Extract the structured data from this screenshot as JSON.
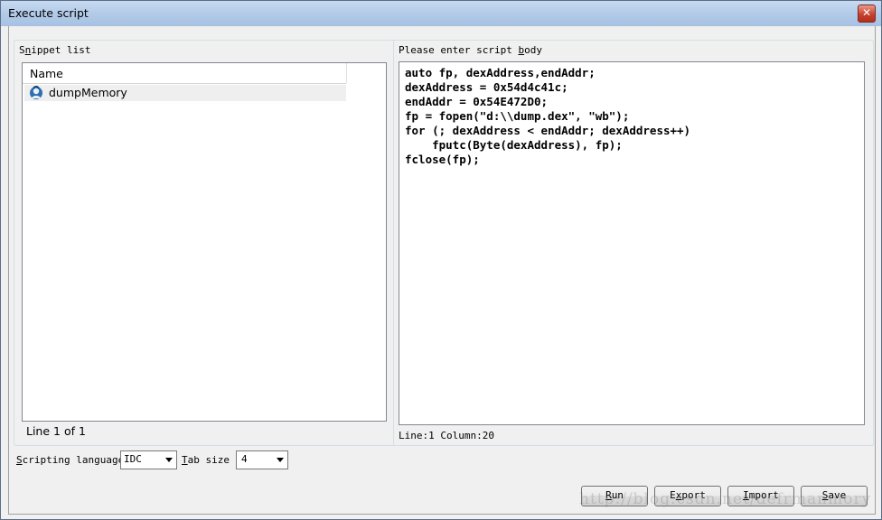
{
  "window": {
    "title": "Execute script",
    "close_glyph": "✕"
  },
  "snippet_list": {
    "group_label_prefix": "S",
    "group_label_accel": "n",
    "group_label_rest": "ippet list",
    "column_header": "Name",
    "items": [
      {
        "label": "dumpMemory",
        "icon": "snippet-icon"
      }
    ],
    "status": "Line 1 of 1"
  },
  "script_body": {
    "label_main": "Please enter script ",
    "label_accel": "b",
    "label_rest": "ody",
    "lines": [
      "auto fp, dexAddress,endAddr;",
      "dexAddress = 0x54d4c41c;",
      "endAddr = 0x54E472D0;",
      "fp = fopen(\"d:\\\\dump.dex\", \"wb\");",
      "for (; dexAddress < endAddr; dexAddress++)",
      "    fputc(Byte(dexAddress), fp);",
      "fclose(fp);"
    ],
    "cursor_status": "Line:1  Column:20"
  },
  "options": {
    "scripting_language_accel": "S",
    "scripting_language_rest": "cripting language",
    "scripting_language_value": "IDC",
    "tab_size_accel": "T",
    "tab_size_rest": "ab size",
    "tab_size_value": "4"
  },
  "buttons": {
    "run_accel": "R",
    "run_rest": "un",
    "export_pre": "E",
    "export_accel": "x",
    "export_rest": "port",
    "import_accel": "I",
    "import_rest": "mport",
    "save_accel": "S",
    "save_rest": "ave"
  },
  "watermark": "http://blog.csdn.net/defrmanmory"
}
